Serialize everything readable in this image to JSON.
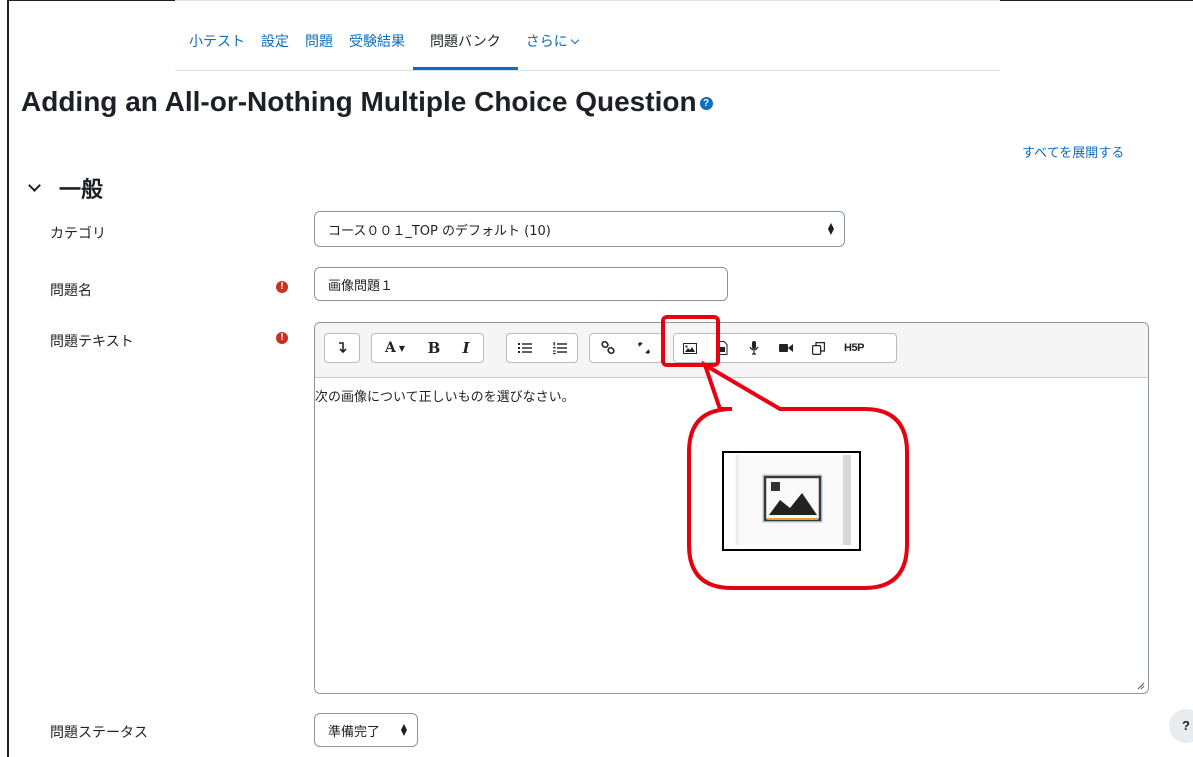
{
  "nav": {
    "tabs": [
      {
        "label": "小テスト"
      },
      {
        "label": "設定"
      },
      {
        "label": "問題"
      },
      {
        "label": "受験結果"
      },
      {
        "label": "問題バンク"
      },
      {
        "label": "さらに"
      }
    ],
    "active_tab": "問題バンク"
  },
  "page": {
    "title": "Adding an All-or-Nothing Multiple Choice Question",
    "expand_all": "すべてを展開する"
  },
  "section": {
    "title": "一般"
  },
  "form": {
    "category_label": "カテゴリ",
    "category_value": "コース００１_TOP のデフォルト (10)",
    "name_label": "問題名",
    "name_value": "画像問題１",
    "text_label": "問題テキスト",
    "text_value": "次の画像について正しいものを選びなさい。",
    "status_label": "問題ステータス",
    "status_value": "準備完了"
  },
  "toolbar": {
    "buttons": [
      "collapse-icon",
      "font-style-icon",
      "bold-icon",
      "italic-icon",
      "unordered-list-icon",
      "ordered-list-icon",
      "link-icon",
      "unlink-icon",
      "image-icon",
      "media-icon",
      "microphone-icon",
      "video-icon",
      "copy-icon",
      "h5p-icon"
    ],
    "bold": "B",
    "italic": "I",
    "font": "A",
    "h5p": "H5P"
  },
  "help_fab": "?",
  "colors": {
    "accent": "#0f6cbf",
    "required": "#ca3120",
    "highlight": "#e60012"
  }
}
